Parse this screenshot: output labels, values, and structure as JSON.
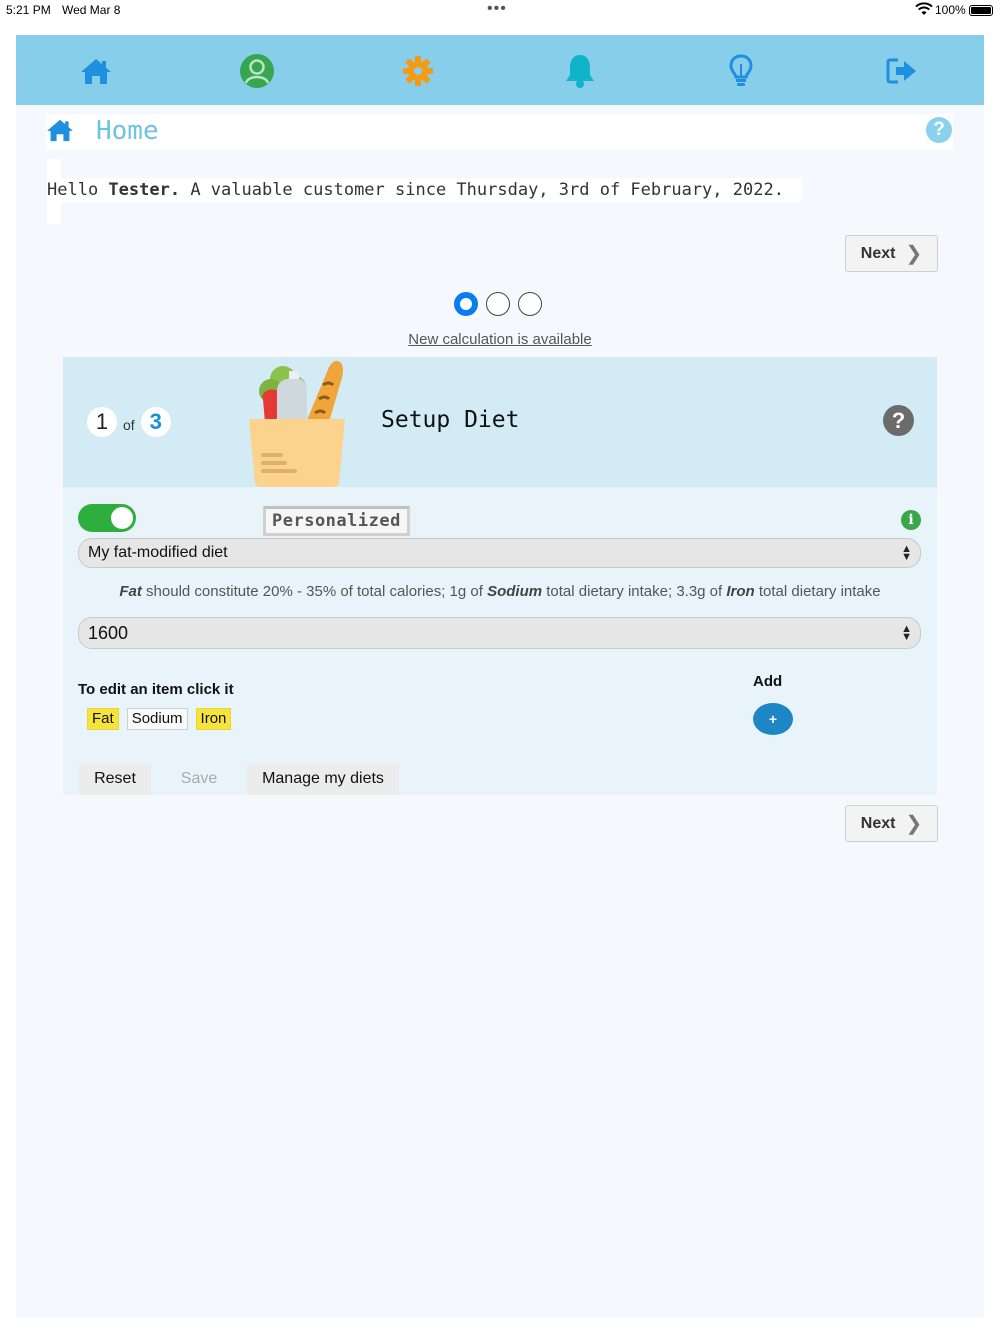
{
  "status_bar": {
    "time": "5:21 PM",
    "date": "Wed Mar 8",
    "dots": "•••",
    "battery": "100%"
  },
  "nav": {
    "icons": [
      "home-icon",
      "user-icon",
      "gear-icon",
      "bell-icon",
      "lightbulb-icon",
      "logout-icon"
    ],
    "bar_color": "#87ceeb"
  },
  "header": {
    "title": "Home",
    "help": "?"
  },
  "greeting": {
    "prefix": "Hello ",
    "name": "Tester.",
    "suffix": " A valuable customer since Thursday, 3rd of February, 2022."
  },
  "next_label": "Next",
  "pager": {
    "total": 3,
    "active": 1
  },
  "calc_link": "New calculation is available",
  "step": {
    "current": "1",
    "of": "of",
    "total": "3",
    "title": "Setup Diet",
    "help": "?"
  },
  "diet": {
    "toggle_on": true,
    "personalized_label": "Personalized",
    "info": "i",
    "selected_diet": "My fat-modified diet",
    "guidance": {
      "fat_name": "Fat",
      "fat_text": " should constitute 20% - 35% of total calories; 1g of ",
      "sodium_name": "Sodium",
      "sodium_text": " total dietary intake; 3.3g of ",
      "iron_name": "Iron",
      "iron_text": " total dietary intake"
    },
    "calories": "1600",
    "edit_label": "To edit an item click it",
    "items": [
      {
        "label": "Fat",
        "highlight": true
      },
      {
        "label": "Sodium",
        "highlight": false
      },
      {
        "label": "Iron",
        "highlight": true
      }
    ],
    "add_label": "Add",
    "add_button": "+",
    "actions": {
      "reset": "Reset",
      "save": "Save",
      "manage": "Manage my diets"
    }
  },
  "colors": {
    "accent_blue": "#0a7cf0",
    "toggle_green": "#2eae3c",
    "highlight_yellow": "#f6e43c",
    "add_blue": "#1d86c5"
  }
}
